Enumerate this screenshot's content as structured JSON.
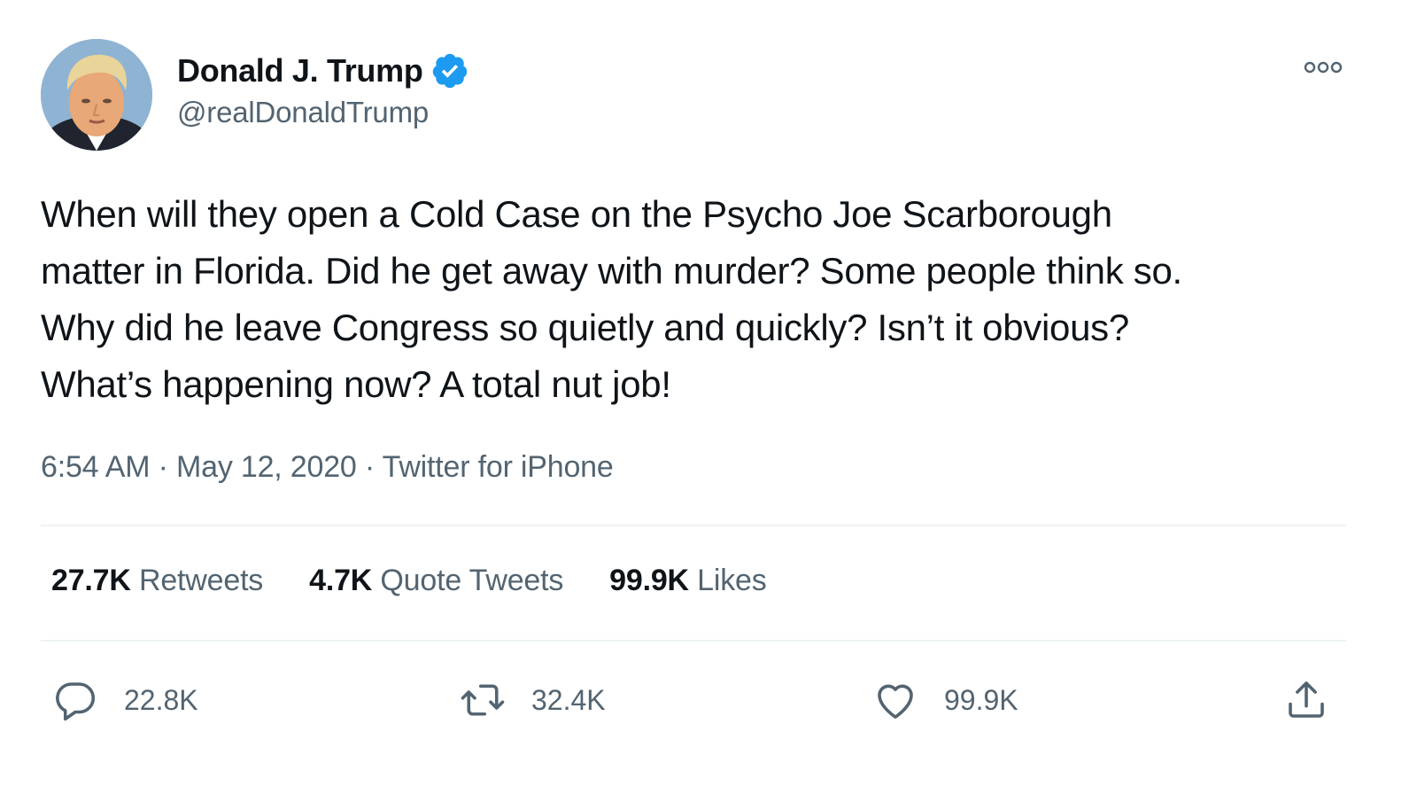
{
  "author": {
    "display_name": "Donald J. Trump",
    "handle": "@realDonaldTrump",
    "avatar_icon": "avatar-photo",
    "verified_icon": "verified-badge-icon"
  },
  "tweet": {
    "lines": [
      "When will they open a Cold Case on the Psycho Joe Scarborough",
      "matter in Florida. Did he get away with murder? Some people think so.",
      "Why did he leave Congress so quietly and quickly? Isn’t it obvious?",
      "What’s happening now? A total nut job!"
    ],
    "time": "6:54 AM",
    "sep1": " · ",
    "date": "May 12, 2020",
    "sep2": " · ",
    "source": "Twitter for iPhone"
  },
  "stats": {
    "retweets_count": "27.7K",
    "retweets_label": "Retweets",
    "quotes_count": "4.7K",
    "quotes_label": "Quote Tweets",
    "likes_count": "99.9K",
    "likes_label": "Likes"
  },
  "actions": {
    "reply_count": "22.8K",
    "retweet_count": "32.4K",
    "like_count": "99.9K"
  },
  "colors": {
    "text": "#0f1419",
    "secondary": "#536471",
    "verified": "#1d9bf0",
    "divider": "#eff3f4"
  }
}
